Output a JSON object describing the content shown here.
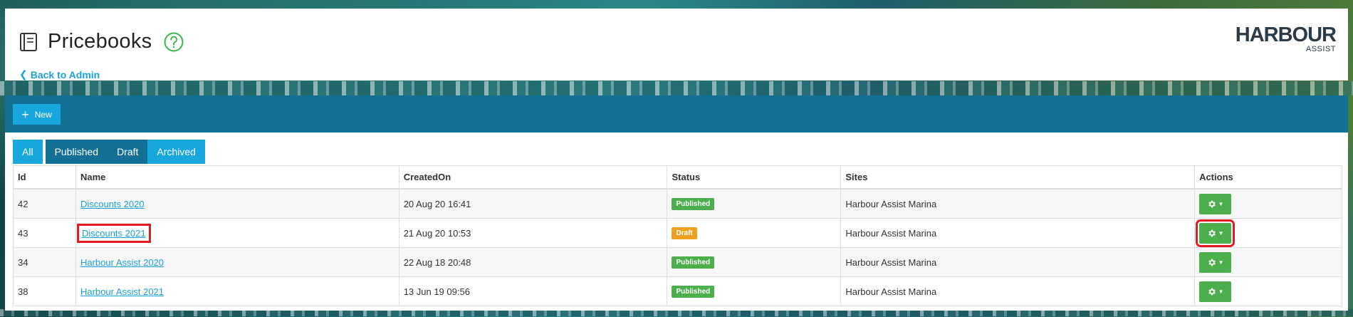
{
  "header": {
    "title": "Pricebooks",
    "back_label": "Back to Admin",
    "logo_main": "HARBOUR",
    "logo_sub": "ASSIST"
  },
  "toolbar": {
    "new_label": "New"
  },
  "tabs": [
    {
      "label": "All"
    },
    {
      "label": "Published"
    },
    {
      "label": "Draft"
    },
    {
      "label": "Archived"
    }
  ],
  "table": {
    "columns": [
      "Id",
      "Name",
      "CreatedOn",
      "Status",
      "Sites",
      "Actions"
    ],
    "rows": [
      {
        "id": "42",
        "name": "Discounts 2020",
        "created": "20 Aug 20 16:41",
        "status": "Published",
        "site": "Harbour Assist Marina"
      },
      {
        "id": "43",
        "name": "Discounts 2021",
        "created": "21 Aug 20 10:53",
        "status": "Draft",
        "site": "Harbour Assist Marina"
      },
      {
        "id": "34",
        "name": "Harbour Assist 2020",
        "created": "22 Aug 18 20:48",
        "status": "Published",
        "site": "Harbour Assist Marina"
      },
      {
        "id": "38",
        "name": "Harbour Assist 2021",
        "created": "13 Jun 19 09:56",
        "status": "Published",
        "site": "Harbour Assist Marina"
      }
    ]
  },
  "icons": {
    "title": "book-icon",
    "help": "help-circle-icon",
    "back": "chevron-left-icon",
    "new": "plus-icon",
    "actions": "gear-icon"
  },
  "colors": {
    "accent": "#18a7dc",
    "toolbar": "#127094",
    "published": "#4cae4c",
    "draft": "#f0a020",
    "highlight": "#e21b23",
    "help": "#3cb54a"
  }
}
